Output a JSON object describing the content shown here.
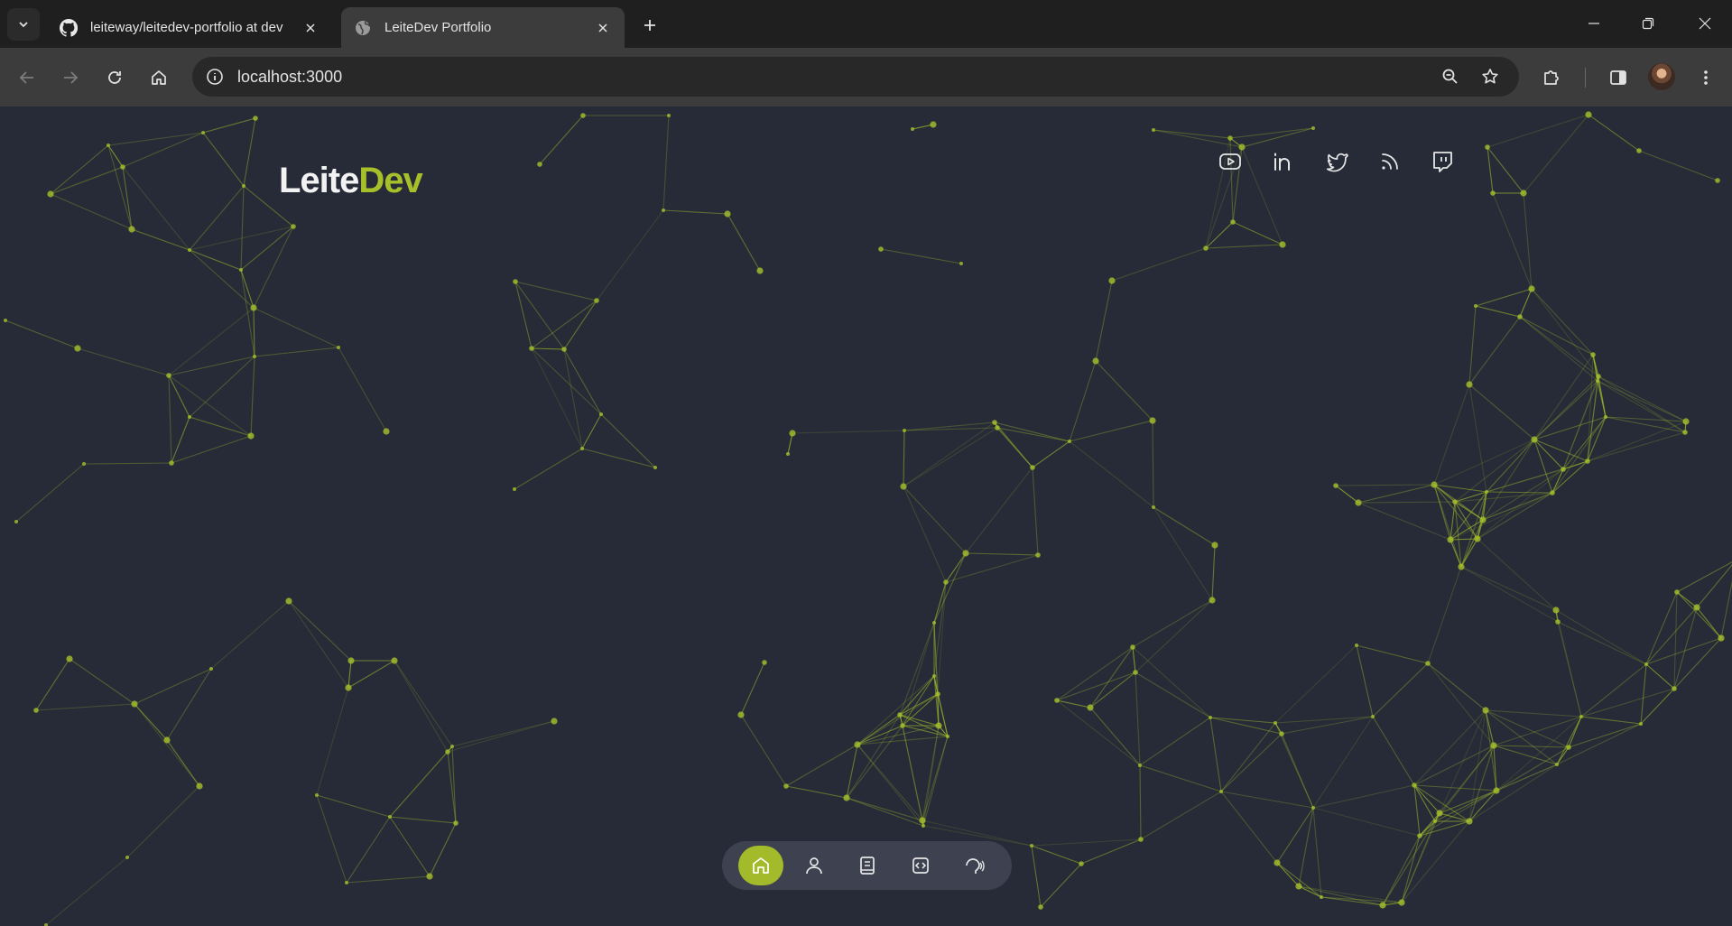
{
  "browser": {
    "tabs": [
      {
        "title": "leiteway/leitedev-portfolio at dev",
        "favicon": "github-icon",
        "active": false
      },
      {
        "title": "LeiteDev Portfolio",
        "favicon": "globe-icon",
        "active": true
      }
    ],
    "url": "localhost:3000"
  },
  "page": {
    "logo": {
      "part1": "Leite",
      "part2": "Dev"
    },
    "social_links": [
      "youtube-icon",
      "linkedin-icon",
      "twitter-icon",
      "rss-icon",
      "twitch-icon"
    ],
    "nav": [
      {
        "icon": "home-icon",
        "active": true
      },
      {
        "icon": "user-icon",
        "active": false
      },
      {
        "icon": "book-icon",
        "active": false
      },
      {
        "icon": "code-icon",
        "active": false
      },
      {
        "icon": "podcast-icon",
        "active": false
      }
    ]
  },
  "colors": {
    "accent": "#a7c02a",
    "background": "#272b38",
    "dock": "#3d4150"
  }
}
